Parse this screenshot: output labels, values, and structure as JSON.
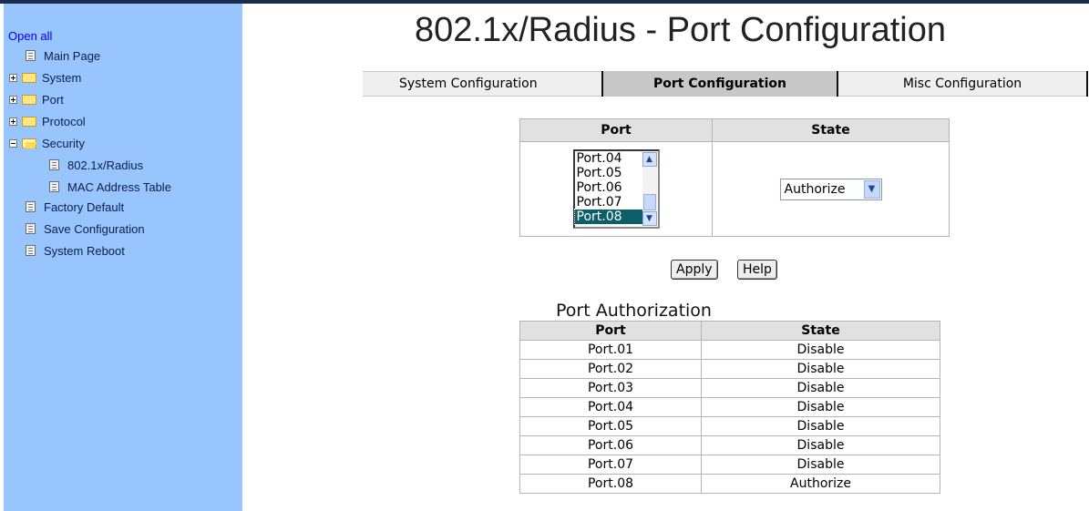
{
  "sidebar": {
    "open_all": "Open all",
    "items": [
      {
        "label": "Main Page"
      },
      {
        "label": "System"
      },
      {
        "label": "Port"
      },
      {
        "label": "Protocol"
      },
      {
        "label": "Security"
      },
      {
        "label": "802.1x/Radius"
      },
      {
        "label": "MAC Address Table"
      },
      {
        "label": "Factory Default"
      },
      {
        "label": "Save Configuration"
      },
      {
        "label": "System Reboot"
      }
    ]
  },
  "page_title": "802.1x/Radius - Port Configuration",
  "tabs": [
    {
      "label": "System Configuration",
      "active": false
    },
    {
      "label": "Port Configuration",
      "active": true
    },
    {
      "label": "Misc Configuration",
      "active": false
    }
  ],
  "config_table": {
    "headers": {
      "port": "Port",
      "state": "State"
    },
    "port_list": [
      "Port.04",
      "Port.05",
      "Port.06",
      "Port.07",
      "Port.08"
    ],
    "selected_port": "Port.08",
    "state_value": "Authorize"
  },
  "buttons": {
    "apply": "Apply",
    "help": "Help"
  },
  "authorization": {
    "title": "Port Authorization",
    "headers": {
      "port": "Port",
      "state": "State"
    },
    "rows": [
      {
        "port": "Port.01",
        "state": "Disable"
      },
      {
        "port": "Port.02",
        "state": "Disable"
      },
      {
        "port": "Port.03",
        "state": "Disable"
      },
      {
        "port": "Port.04",
        "state": "Disable"
      },
      {
        "port": "Port.05",
        "state": "Disable"
      },
      {
        "port": "Port.06",
        "state": "Disable"
      },
      {
        "port": "Port.07",
        "state": "Disable"
      },
      {
        "port": "Port.08",
        "state": "Authorize"
      }
    ]
  },
  "colors": {
    "sidebar_bg": "#99c5ff",
    "selected_bg": "#0e5e6a",
    "header_bg": "#e1e1e1"
  }
}
